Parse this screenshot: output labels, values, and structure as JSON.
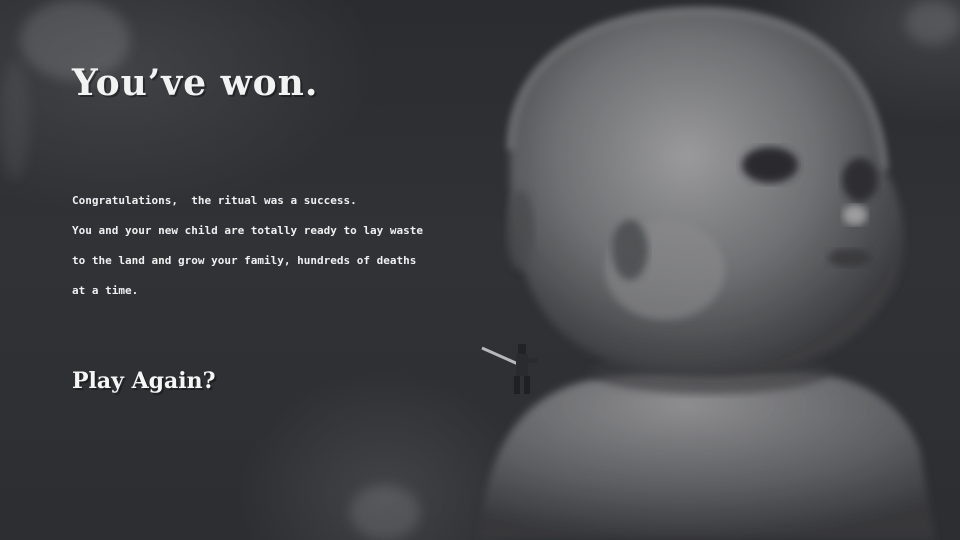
{
  "end_screen": {
    "title": "You’ve won.",
    "message_lines": [
      "Congratulations,  the ritual was a success.",
      "You and your new child are totally ready to lay waste",
      "to the land and grow your family, hundreds of deaths",
      "at a time."
    ],
    "play_again_label": "Play Again?"
  },
  "colors": {
    "background": "#2b2d31",
    "text": "#f2f2f2"
  },
  "art": {
    "portrait": "baby-portrait",
    "figure": "tiny-warrior-with-sword"
  }
}
